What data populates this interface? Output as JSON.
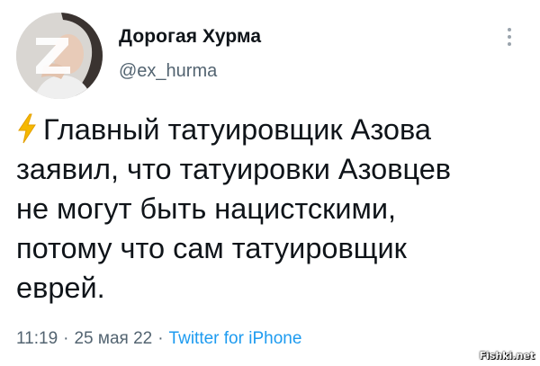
{
  "author": {
    "display_name": "Дорогая Хурма",
    "handle": "@ex_hurma"
  },
  "tweet": {
    "lines": [
      "Главный татуировщик Азова",
      "заявил, что татуировки Азовцев",
      "не могут быть нацистскими,",
      "потому что сам татуировщик",
      "еврей."
    ],
    "lead_icon": "high-voltage-emoji"
  },
  "meta": {
    "time": "11:19",
    "date": "25 мая 22",
    "separator": "·",
    "source": "Twitter for iPhone"
  },
  "watermark": "Fishki.net",
  "colors": {
    "text": "#0f1419",
    "secondary": "#536471",
    "link": "#1d9bf0",
    "bolt": "#f5b800"
  },
  "icons": {
    "more": "more-vertical-icon",
    "avatar_overlay": "letter-z-symbol"
  }
}
